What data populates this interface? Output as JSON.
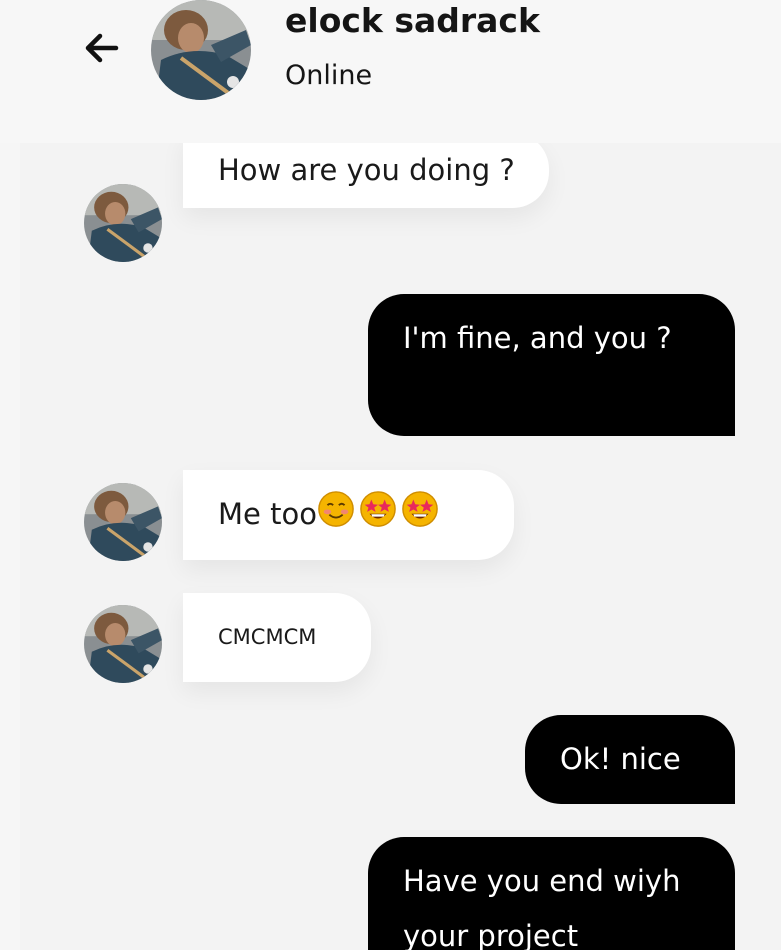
{
  "header": {
    "contact_name": "elock sadrack",
    "status": "Online"
  },
  "icons": {
    "back": "arrow-left-icon",
    "emoji": "star-struck-emoji"
  },
  "colors": {
    "outgoing_bubble": "#000000",
    "incoming_bubble": "#ffffff",
    "background": "#f6f6f6"
  },
  "messages": [
    {
      "direction": "incoming",
      "text": "How are you doing ?"
    },
    {
      "direction": "outgoing",
      "text": "I'm fine, and you ?"
    },
    {
      "direction": "incoming",
      "text": "Me too",
      "emojis": [
        "😊",
        "🤩",
        "🤩"
      ]
    },
    {
      "direction": "incoming",
      "text": "CMCMCM"
    },
    {
      "direction": "outgoing",
      "text": "Ok! nice"
    },
    {
      "direction": "outgoing",
      "text": "Have you end wiyh your project"
    }
  ]
}
